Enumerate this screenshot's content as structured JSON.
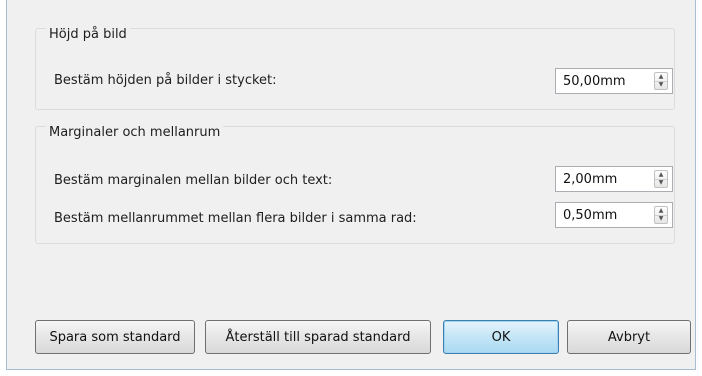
{
  "groups": {
    "image_height": {
      "title": "Höjd på bild",
      "rows": [
        {
          "label": "Bestäm höjden på bilder i stycket:",
          "value": "50,00mm"
        }
      ]
    },
    "margins": {
      "title": "Marginaler och mellanrum",
      "rows": [
        {
          "label": "Bestäm marginalen mellan bilder och text:",
          "value": "2,00mm"
        },
        {
          "label": "Bestäm mellanrummet mellan flera bilder i samma rad:",
          "value": "0,50mm"
        }
      ]
    }
  },
  "spinner_icons": {
    "up": "arrow-up-icon",
    "down": "arrow-down-icon"
  },
  "buttons": {
    "save_default": "Spara som standard",
    "restore_default": "Återställ till sparad standard",
    "ok": "OK",
    "cancel": "Avbryt"
  },
  "colors": {
    "dialog_bg": "#f0f0f0",
    "window_border": "#a9bcd2",
    "default_button": "#c4e5f6"
  }
}
